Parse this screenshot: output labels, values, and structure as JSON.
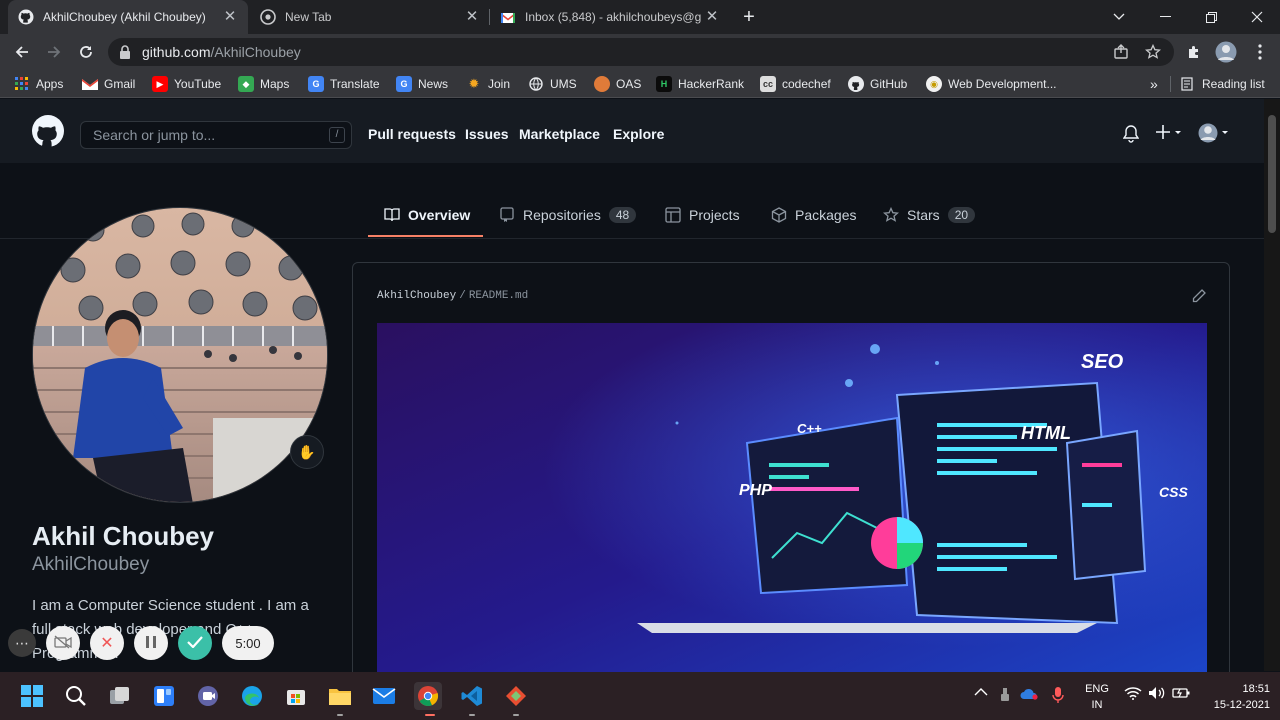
{
  "browser": {
    "tabs": [
      {
        "title": "AkhilChoubey (Akhil Choubey)",
        "active": true
      },
      {
        "title": "New Tab",
        "active": false
      },
      {
        "title": "Inbox (5,848) - akhilchoubeys@g",
        "active": false
      }
    ],
    "url_host": "github.com",
    "url_path": "/AkhilChoubey",
    "bookmarks": [
      "Apps",
      "Gmail",
      "YouTube",
      "Maps",
      "Translate",
      "News",
      "Join",
      "UMS",
      "OAS",
      "HackerRank",
      "codechef",
      "GitHub",
      "Web Development..."
    ],
    "bookmarks_overflow": "»",
    "reading_list": "Reading list"
  },
  "github": {
    "search_placeholder": "Search or jump to...",
    "search_key": "/",
    "nav": [
      "Pull requests",
      "Issues",
      "Marketplace",
      "Explore"
    ],
    "profile_tabs": [
      {
        "label": "Overview",
        "count": null
      },
      {
        "label": "Repositories",
        "count": "48"
      },
      {
        "label": "Projects",
        "count": null
      },
      {
        "label": "Packages",
        "count": null
      },
      {
        "label": "Stars",
        "count": "20"
      }
    ],
    "profile": {
      "name": "Akhil Choubey",
      "login": "AkhilChoubey",
      "bio": "I am a Computer Science student . I am a full stack web developer and C++ Programmer."
    },
    "readme": {
      "owner": "AkhilChoubey",
      "separator": "/",
      "file": "README.md",
      "banner_labels": [
        "SEO",
        "C++",
        "HTML",
        "PHP",
        "CSS"
      ]
    }
  },
  "recorder": {
    "timer": "5:00"
  },
  "taskbar": {
    "lang_line1": "ENG",
    "lang_line2": "IN",
    "time": "18:51",
    "date": "15-12-2021"
  },
  "colors": {
    "accent_underline": "#f78166",
    "header_bg": "#161b22",
    "page_bg": "#0d1117"
  }
}
